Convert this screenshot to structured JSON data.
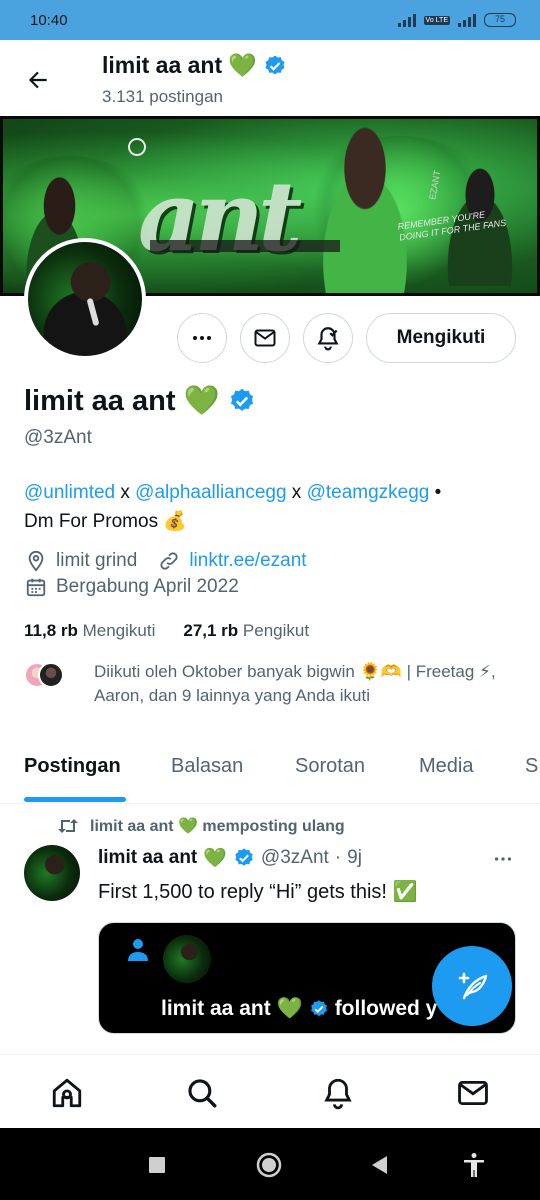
{
  "status_bar": {
    "time": "10:40",
    "network_label": "Vo LTE",
    "battery": "75"
  },
  "header": {
    "name": "limit aa ant",
    "heart": "💚",
    "post_count": "3.131 postingan"
  },
  "profile": {
    "name": "limit aa ant",
    "heart": "💚",
    "handle": "@3zAnt",
    "follow_button": "Mengikuti",
    "bio": {
      "mention1": "@unlimted",
      "sep1": " x ",
      "mention2": "@alphaalliancegg",
      "sep2": " x ",
      "mention3": "@teamgzkegg",
      "sep3": " •",
      "line2": "Dm For Promos 💰"
    },
    "location": "limit grind",
    "website": "linktr.ee/ezant",
    "joined": "Bergabung April 2022",
    "following_count": "11,8 rb",
    "following_label": "Mengikuti",
    "followers_count": "27,1 rb",
    "followers_label": "Pengikut",
    "followed_by": "Diikuti oleh Oktober banyak bigwin 🌻🫶 | Freetag ⚡, Aaron, dan 9 lainnya yang Anda ikuti"
  },
  "banner": {
    "art_text": "ant",
    "tag_text": "REMEMBER YOU'RE DOING IT FOR THE FANS",
    "side_text": "EZANT"
  },
  "tabs": [
    {
      "label": "Postingan"
    },
    {
      "label": "Balasan"
    },
    {
      "label": "Sorotan"
    },
    {
      "label": "Media"
    },
    {
      "label": "S"
    }
  ],
  "post": {
    "repost_label": "limit aa ant 💚 memposting ulang",
    "author_name": "limit aa ant",
    "author_heart": "💚",
    "author_handle": "@3zAnt",
    "dot": "·",
    "time": "9j",
    "text": "First 1,500 to reply “Hi” gets this! ✅",
    "media_text": "limit aa ant 💚",
    "media_text_suffix": "followed y"
  },
  "colors": {
    "accent": "#1d9bf0",
    "text": "#0f1419",
    "muted": "#536471",
    "status_bar": "#4aa3df"
  },
  "icons": {
    "back": "arrow-left-icon",
    "more": "more-horizontal-icon",
    "message": "mail-icon",
    "notify": "bell-check-icon",
    "location": "location-pin-icon",
    "link": "link-icon",
    "calendar": "calendar-icon",
    "repost": "repost-icon",
    "compose": "compose-post-icon",
    "home": "home-icon",
    "search": "search-icon",
    "notifications": "bell-icon",
    "messages": "mail-icon"
  }
}
